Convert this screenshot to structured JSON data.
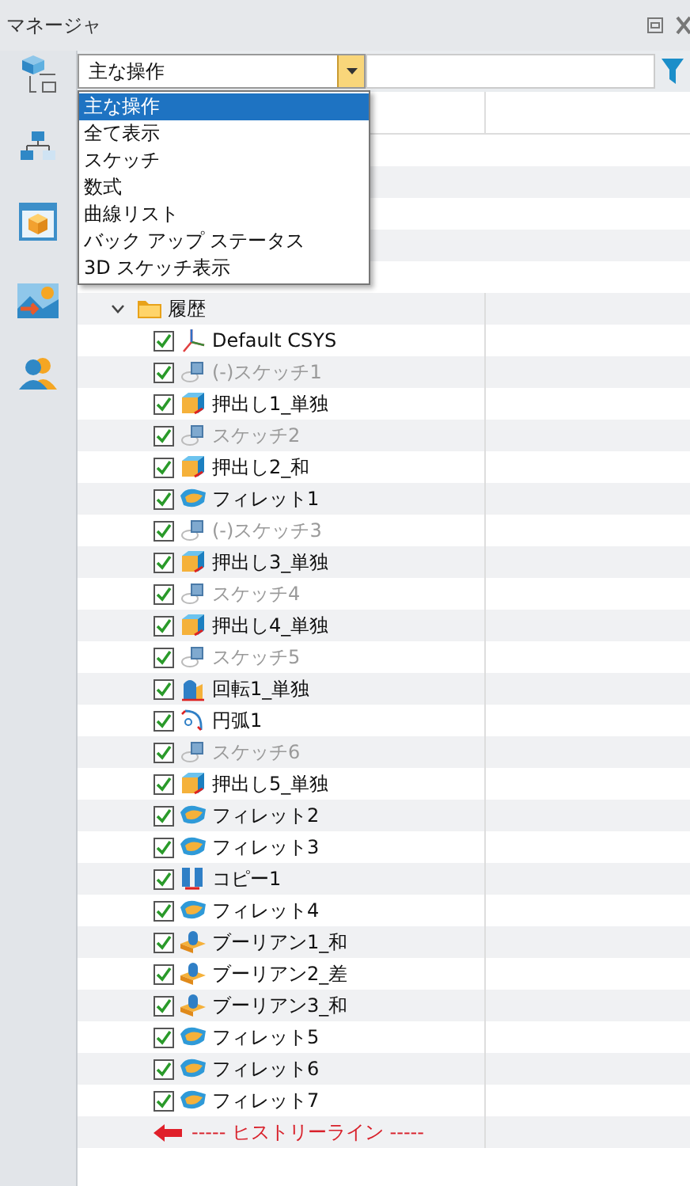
{
  "window": {
    "title": "マネージャ"
  },
  "filter": {
    "value": "主な操作",
    "options": [
      {
        "label": "主な操作",
        "selected": true
      },
      {
        "label": "全て表示",
        "selected": false
      },
      {
        "label": "スケッチ",
        "selected": false
      },
      {
        "label": "数式",
        "selected": false
      },
      {
        "label": "曲線リスト",
        "selected": false
      },
      {
        "label": "バック アップ ステータス",
        "selected": false
      },
      {
        "label": "3D スケッチ表示",
        "selected": false
      }
    ]
  },
  "sidebar": {
    "items": [
      {
        "kind": "tree"
      },
      {
        "kind": "part"
      },
      {
        "kind": "image"
      },
      {
        "kind": "user"
      }
    ]
  },
  "tree": {
    "label": "履歴",
    "expanded": true,
    "children": [
      {
        "label": "Default CSYS",
        "kind": "csys",
        "checked": true,
        "dimmed": false
      },
      {
        "label": "(-)スケッチ1",
        "kind": "sketch",
        "checked": true,
        "dimmed": true
      },
      {
        "label": "押出し1_単独",
        "kind": "extrude",
        "checked": true,
        "dimmed": false
      },
      {
        "label": "スケッチ2",
        "kind": "sketch",
        "checked": true,
        "dimmed": true
      },
      {
        "label": "押出し2_和",
        "kind": "extrude",
        "checked": true,
        "dimmed": false
      },
      {
        "label": "フィレット1",
        "kind": "fillet",
        "checked": true,
        "dimmed": false
      },
      {
        "label": "(-)スケッチ3",
        "kind": "sketch",
        "checked": true,
        "dimmed": true
      },
      {
        "label": "押出し3_単独",
        "kind": "extrude",
        "checked": true,
        "dimmed": false
      },
      {
        "label": "スケッチ4",
        "kind": "sketch",
        "checked": true,
        "dimmed": true
      },
      {
        "label": "押出し4_単独",
        "kind": "extrude",
        "checked": true,
        "dimmed": false
      },
      {
        "label": "スケッチ5",
        "kind": "sketch",
        "checked": true,
        "dimmed": true
      },
      {
        "label": "回転1_単独",
        "kind": "revolve",
        "checked": true,
        "dimmed": false
      },
      {
        "label": "円弧1",
        "kind": "arc",
        "checked": true,
        "dimmed": false
      },
      {
        "label": "スケッチ6",
        "kind": "sketch",
        "checked": true,
        "dimmed": true
      },
      {
        "label": "押出し5_単独",
        "kind": "extrude",
        "checked": true,
        "dimmed": false
      },
      {
        "label": "フィレット2",
        "kind": "fillet",
        "checked": true,
        "dimmed": false
      },
      {
        "label": "フィレット3",
        "kind": "fillet",
        "checked": true,
        "dimmed": false
      },
      {
        "label": "コピー1",
        "kind": "copy",
        "checked": true,
        "dimmed": false
      },
      {
        "label": "フィレット4",
        "kind": "fillet",
        "checked": true,
        "dimmed": false
      },
      {
        "label": "ブーリアン1_和",
        "kind": "boolean",
        "checked": true,
        "dimmed": false
      },
      {
        "label": "ブーリアン2_差",
        "kind": "boolean",
        "checked": true,
        "dimmed": false
      },
      {
        "label": "ブーリアン3_和",
        "kind": "boolean",
        "checked": true,
        "dimmed": false
      },
      {
        "label": "フィレット5",
        "kind": "fillet",
        "checked": true,
        "dimmed": false
      },
      {
        "label": "フィレット6",
        "kind": "fillet",
        "checked": true,
        "dimmed": false
      },
      {
        "label": "フィレット7",
        "kind": "fillet",
        "checked": true,
        "dimmed": false
      }
    ]
  },
  "history_line": {
    "label": "----- ヒストリーライン -----"
  }
}
